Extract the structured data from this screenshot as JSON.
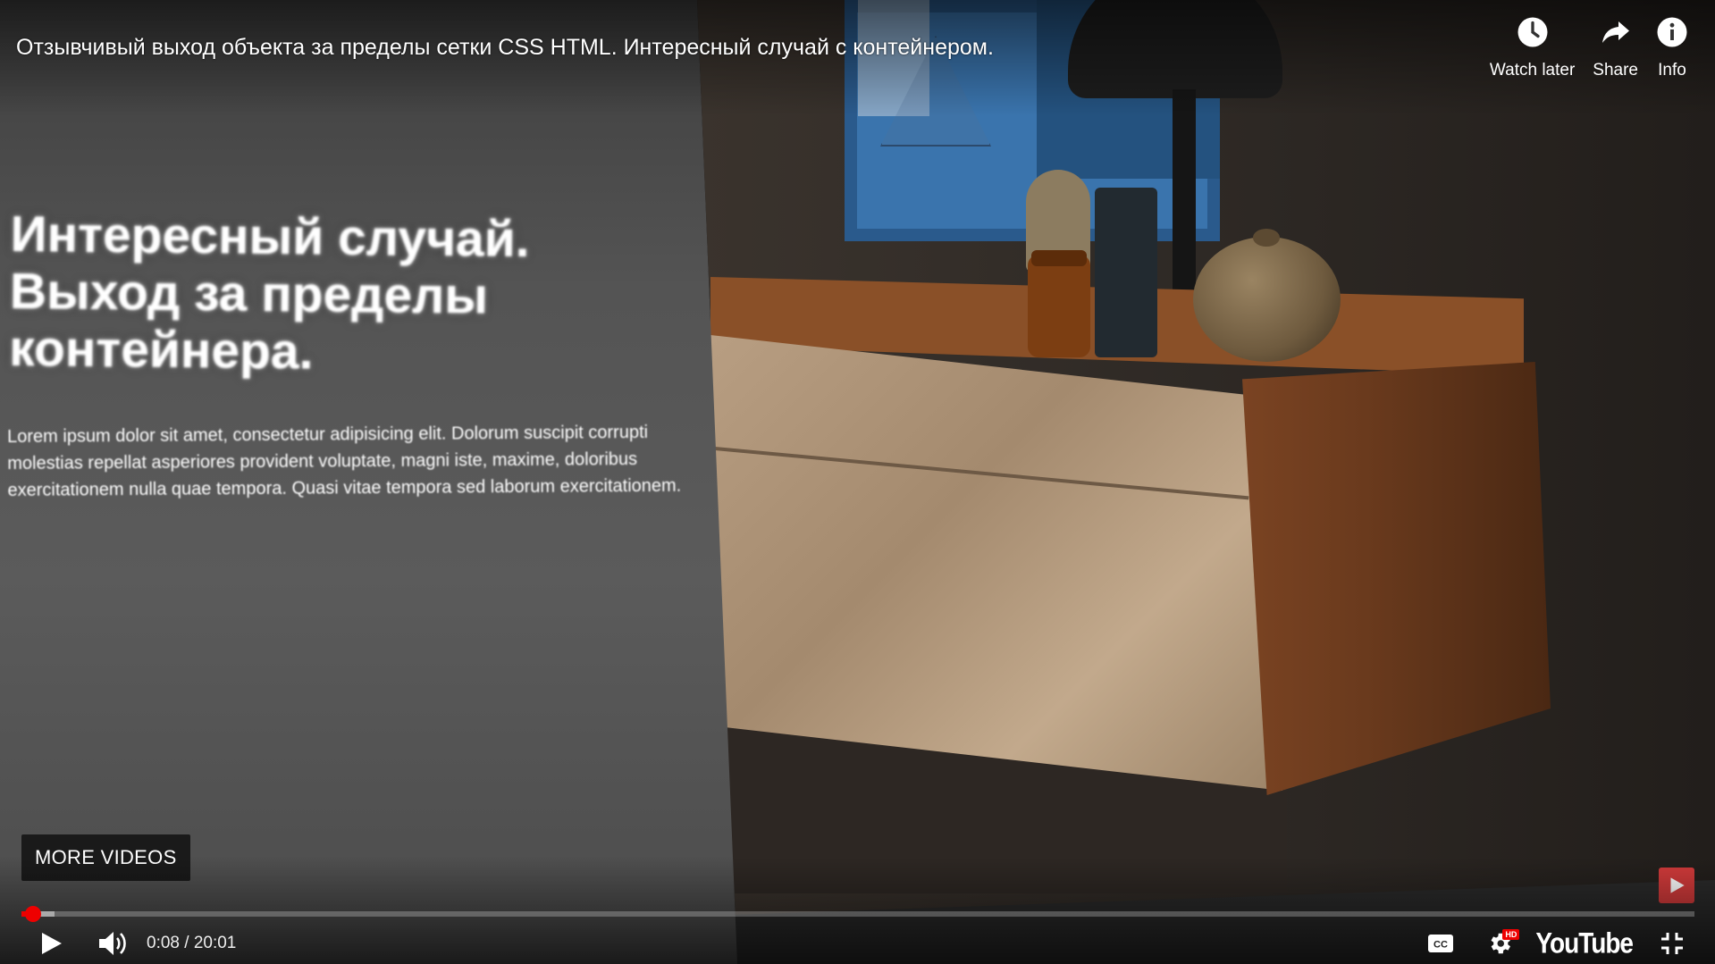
{
  "video": {
    "title": "Отзывчивый выход объекта за пределы сетки CSS HTML. Интересный случай с контейнером.",
    "slide": {
      "heading_lines": [
        "Интересный случай.",
        "Выход за пределы",
        "контейнера."
      ],
      "body_text": "Lorem ipsum dolor sit amet, consectetur adipisicing elit. Dolorum suscipit corrupti molestias repellat asperiores provident voluptate, magni iste, maxime, doloribus exercitationem nulla quae tempora. Quasi vitae tempora sed laborum exercitationem."
    }
  },
  "top_actions": [
    {
      "label": "Watch later",
      "icon": "clock-icon"
    },
    {
      "label": "Share",
      "icon": "share-arrow-icon"
    },
    {
      "label": "Info",
      "icon": "info-icon"
    }
  ],
  "more_videos_label": "MORE VIDEOS",
  "controls": {
    "current_time": "0:08",
    "duration": "20:01",
    "time_display": "0:08 / 20:01",
    "played_fraction": 0.0067,
    "buffered_fraction": 0.02,
    "hd_badge": "HD",
    "logo_text": "YouTube",
    "icons": [
      "play-icon",
      "volume-icon",
      "captions-icon",
      "settings-icon",
      "exit-fullscreen-icon"
    ]
  },
  "colors": {
    "accent": "#ff0000",
    "overlay_text": "#ffffff"
  }
}
